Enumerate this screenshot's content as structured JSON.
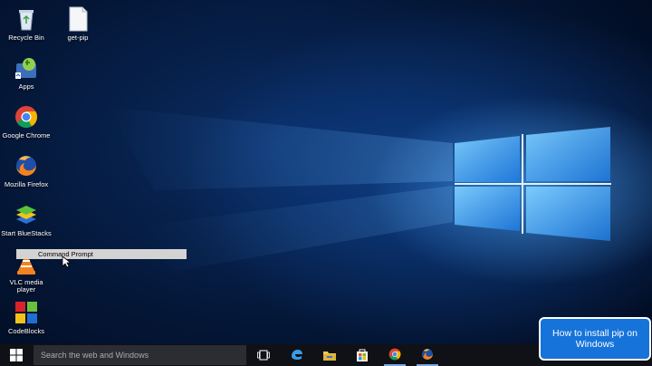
{
  "desktop": {
    "icons": [
      {
        "label": "Recycle Bin",
        "icon": "recycle-bin-icon"
      },
      {
        "label": "get-pip",
        "icon": "file-icon"
      },
      {
        "label": "Apps",
        "icon": "apps-folder-icon"
      },
      {
        "label": "Google Chrome",
        "icon": "chrome-icon"
      },
      {
        "label": "Mozilla Firefox",
        "icon": "firefox-icon"
      },
      {
        "label": "Start BlueStacks",
        "icon": "bluestacks-icon"
      },
      {
        "label": "VLC media player",
        "icon": "vlc-icon"
      },
      {
        "label": "CodeBlocks",
        "icon": "codeblocks-icon"
      }
    ],
    "tooltip": "Command Prompt"
  },
  "taskbar": {
    "search_placeholder": "Search the web and Windows",
    "buttons": [
      "start-icon",
      "task-view-icon",
      "edge-icon",
      "file-explorer-icon",
      "store-icon",
      "chrome-icon",
      "firefox-icon"
    ]
  },
  "overlay": {
    "title": "How to install pip on Windows"
  },
  "colors": {
    "taskbar": "#0f1116",
    "search_box": "#2b2d33",
    "title_card": "#1673d9",
    "wallpaper_glow": "#5ab4ff"
  }
}
